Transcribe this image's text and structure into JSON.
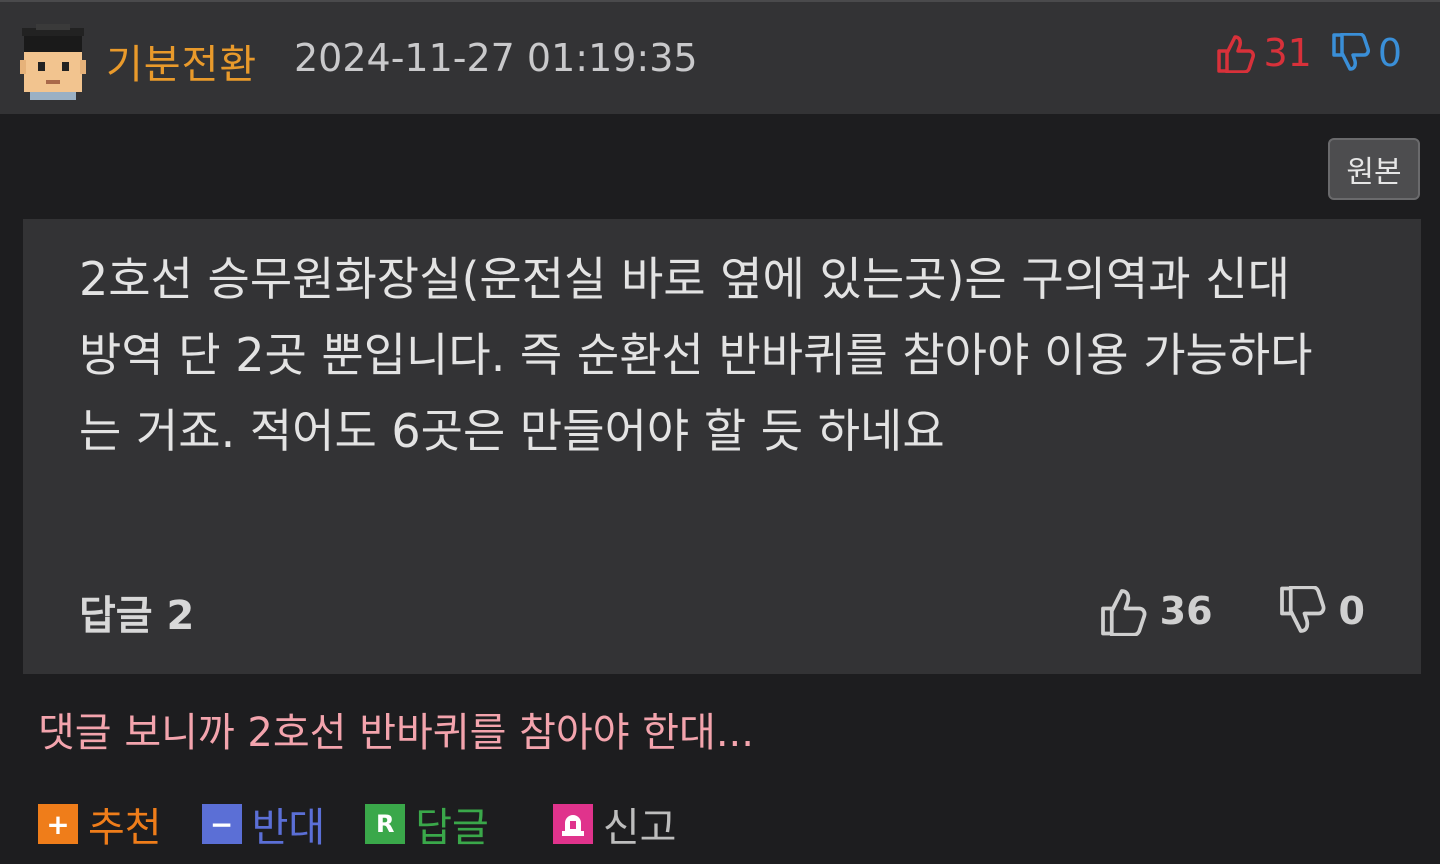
{
  "post": {
    "username": "기분전환",
    "timestamp": "2024-11-27 01:19:35",
    "upvotes": "31",
    "downvotes": "0"
  },
  "original_button": "원본",
  "quote": {
    "text": "2호선 승무원화장실(운전실 바로 옆에 있는곳)은 구의역과 신대방역 단 2곳 뿐입니다. 즉 순환선 반바퀴를 참아야 이용 가능하다는 거죠. 적어도 6곳은 만들어야 할 듯 하네요",
    "reply_label": "답글 2",
    "likes": "36",
    "dislikes": "0"
  },
  "comment": "댓글 보니까 2호선 반바퀴를 참아야 한대...",
  "actions": {
    "recommend": "추천",
    "oppose": "반대",
    "reply": "답글",
    "report": "신고"
  },
  "colors": {
    "username": "#e99a2b",
    "upvote": "#d8313a",
    "downvote": "#3a8fd8",
    "comment": "#f3a4ad",
    "recommend": "#ef7d1a",
    "oppose": "#5b6fd6",
    "reply": "#3aa84a",
    "report": "#e0338c"
  }
}
